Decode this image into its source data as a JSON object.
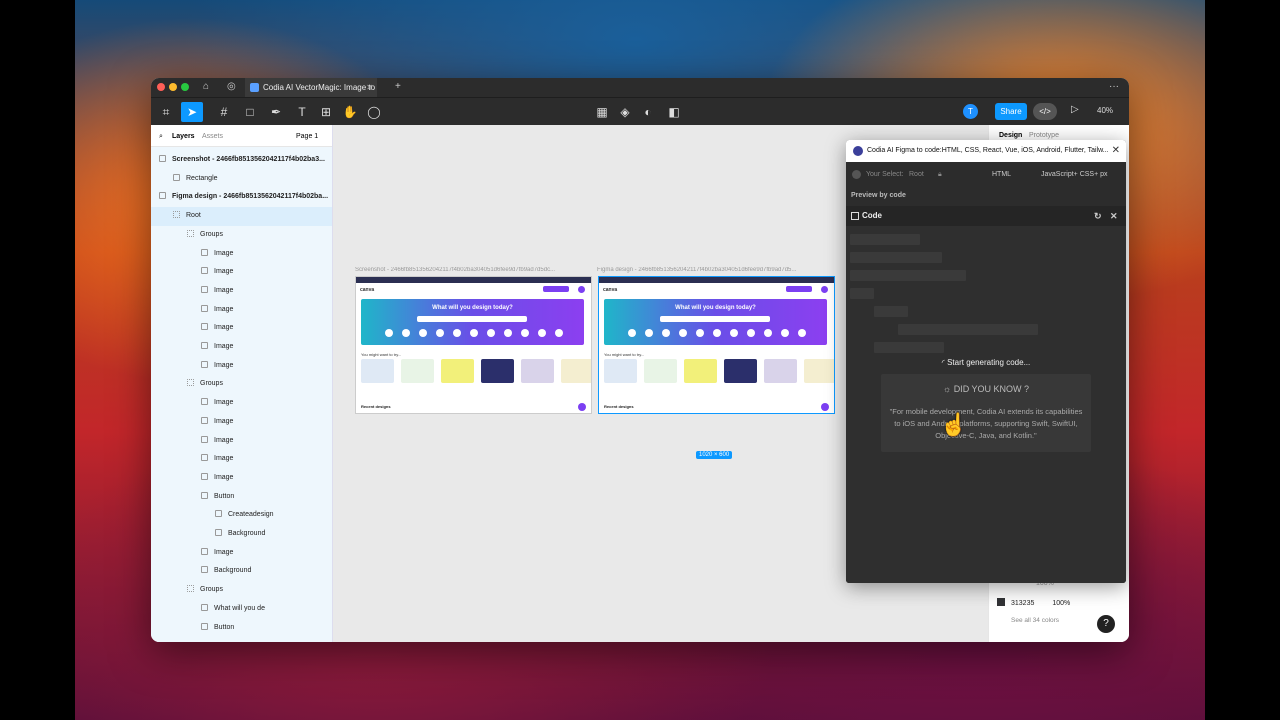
{
  "titlebar": {
    "tab_title": "Codia AI VectorMagic: Image to Fi",
    "new_tab": "+",
    "more": "···"
  },
  "toolbar": {
    "avatar_initial": "T",
    "share_label": "Share",
    "zoom": "40%"
  },
  "layers_panel": {
    "tab_layers": "Layers",
    "tab_assets": "Assets",
    "page": "Page 1",
    "rows": [
      {
        "label": "Screenshot - 2466fb8513562042117f4b02ba3...",
        "indent": 0,
        "bold": true
      },
      {
        "label": "Rectangle",
        "indent": 1
      },
      {
        "label": "Figma design - 2466fb8513562042117f4b02ba...",
        "indent": 0,
        "bold": true
      },
      {
        "label": "Root",
        "indent": 1,
        "selected": true
      },
      {
        "label": "Groups",
        "indent": 2
      },
      {
        "label": "Image",
        "indent": 3
      },
      {
        "label": "Image",
        "indent": 3
      },
      {
        "label": "Image",
        "indent": 3
      },
      {
        "label": "Image",
        "indent": 3
      },
      {
        "label": "Image",
        "indent": 3
      },
      {
        "label": "Image",
        "indent": 3
      },
      {
        "label": "Image",
        "indent": 3
      },
      {
        "label": "Groups",
        "indent": 2
      },
      {
        "label": "Image",
        "indent": 3
      },
      {
        "label": "Image",
        "indent": 3
      },
      {
        "label": "Image",
        "indent": 3
      },
      {
        "label": "Image",
        "indent": 3
      },
      {
        "label": "Image",
        "indent": 3
      },
      {
        "label": "Button",
        "indent": 3
      },
      {
        "label": "Createadesign",
        "indent": 4
      },
      {
        "label": "Background",
        "indent": 4
      },
      {
        "label": "Image",
        "indent": 3
      },
      {
        "label": "Background",
        "indent": 3
      },
      {
        "label": "Groups",
        "indent": 2
      },
      {
        "label": "What will you de",
        "indent": 3
      },
      {
        "label": "Button",
        "indent": 3
      }
    ]
  },
  "canvas": {
    "frame1_label": "Screenshot - 2466fb8513562042117f4b02ba304051d6fee9d7fb9ad7d5dc...",
    "frame2_label": "Figma design - 2466fb8513562042117f4b02ba304051d6fee9d7fb9ad7d5...",
    "logo": "canva",
    "hero_title": "What will you design today?",
    "sub_heading": "You might want to try...",
    "recent": "Recent designs",
    "dimensions": "1020 × 600"
  },
  "right_panel": {
    "tab_design": "Design",
    "tab_prototype": "Prototype",
    "color_hex": "313235",
    "color_opacity": "100%",
    "color_opacity_above": "100%",
    "see_all": "See all 34 colors",
    "help": "?",
    "swatch_color": "#313235"
  },
  "plugin": {
    "title": "Codia AI Figma to code:HTML, CSS, React, Vue, iOS, Android, Flutter, Tailw...",
    "your_select": "Your Select:",
    "select_value": "Root",
    "framework": "HTML",
    "language": "JavaScript+ CSS+ px",
    "preview_label": "Preview by code",
    "code_title": "Code",
    "generating": "Start generating code...",
    "dyk_title": "DID YOU KNOW ?",
    "dyk_text": "\"For mobile development, Codia AI extends its capabilities to iOS and Android platforms, supporting Swift, SwiftUI, Objective-C, Java, and Kotlin.\""
  },
  "colors": {
    "accent": "#0d99ff",
    "brand_purple": "#7b3ff2"
  }
}
